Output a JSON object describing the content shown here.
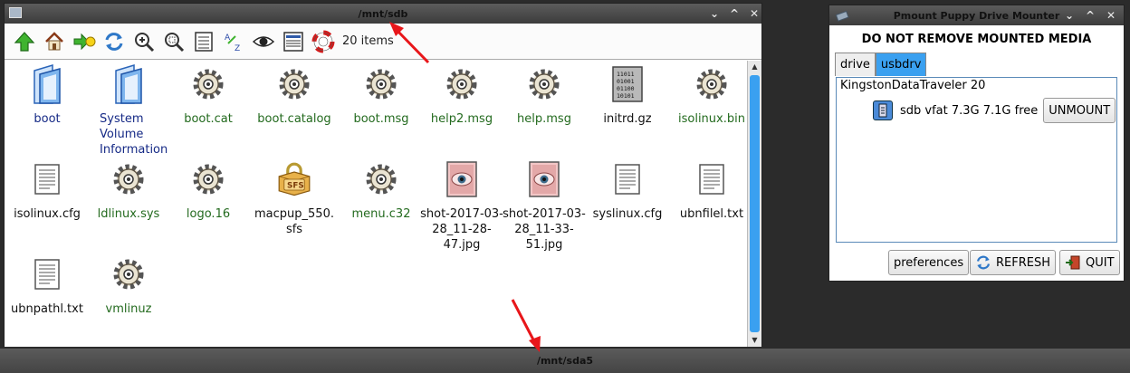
{
  "filer": {
    "title": "/mnt/sdb",
    "item_count": "20 items",
    "controls": {
      "minimize": "⌄",
      "maximize": "^",
      "close": "✕"
    },
    "toolbar_icons": [
      "up-arrow-icon",
      "home-icon",
      "goto-arrow-icon",
      "refresh-icon",
      "zoom-in-icon",
      "zoom-fit-icon",
      "details-icon",
      "sort-az-icon",
      "eye-icon",
      "list-view-icon",
      "help-icon"
    ],
    "files": [
      {
        "name": "boot",
        "kind": "dir"
      },
      {
        "name": "System Volume Information",
        "kind": "dir"
      },
      {
        "name": "boot.cat",
        "kind": "exe"
      },
      {
        "name": "boot.catalog",
        "kind": "exe"
      },
      {
        "name": "boot.msg",
        "kind": "exe"
      },
      {
        "name": "help2.msg",
        "kind": "exe"
      },
      {
        "name": "help.msg",
        "kind": "exe"
      },
      {
        "name": "initrd.gz",
        "kind": "bin"
      },
      {
        "name": "isolinux.bin",
        "kind": "exe"
      },
      {
        "name": "isolinux.cfg",
        "kind": "doc"
      },
      {
        "name": "ldlinux.sys",
        "kind": "exe"
      },
      {
        "name": "logo.16",
        "kind": "exe"
      },
      {
        "name": "macpup_550.sfs",
        "kind": "sfs"
      },
      {
        "name": "menu.c32",
        "kind": "exe"
      },
      {
        "name": "shot-2017-03-28_11-28-47.jpg",
        "kind": "img"
      },
      {
        "name": "shot-2017-03-28_11-33-51.jpg",
        "kind": "img"
      },
      {
        "name": "syslinux.cfg",
        "kind": "doc"
      },
      {
        "name": "ubnfilel.txt",
        "kind": "doc"
      },
      {
        "name": "ubnpathl.txt",
        "kind": "doc"
      },
      {
        "name": "vmlinuz",
        "kind": "exe"
      }
    ]
  },
  "pmount": {
    "title": "Pmount Puppy Drive Mounter",
    "heading": "DO NOT REMOVE MOUNTED MEDIA",
    "tabs": [
      "drive",
      "usbdrv"
    ],
    "active_tab": "usbdrv",
    "device_name": "KingstonDataTraveler 20",
    "device_info": "sdb vfat 7.3G 7.1G free",
    "unmount_label": "UNMOUNT",
    "preferences_label": "preferences",
    "refresh_label": "REFRESH",
    "quit_label": "QUIT"
  },
  "bottom_bar": {
    "title": "/mnt/sda5"
  },
  "colors": {
    "accent": "#3aa0f0",
    "dir_text": "#162a86",
    "exe_text": "#236a1e",
    "annotation_arrow": "#e8161a"
  }
}
